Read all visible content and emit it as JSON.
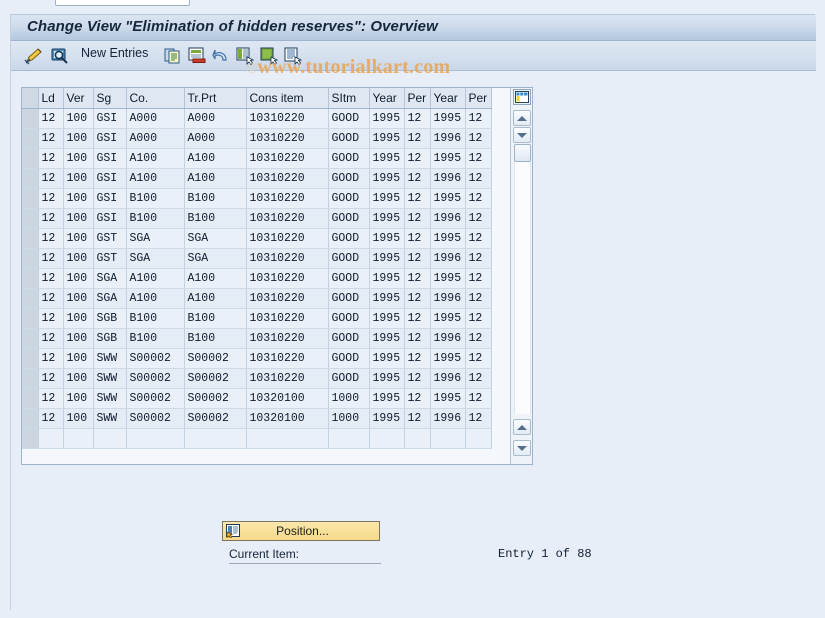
{
  "window": {
    "title": "Change View \"Elimination of hidden reserves\": Overview"
  },
  "watermark": {
    "copyright_mark": "©",
    "text": "www.tutorialkart.com",
    "color": "#e8a85c"
  },
  "toolbar": {
    "items": [
      {
        "name": "display-change-icon",
        "label": ""
      },
      {
        "name": "check-entries-icon",
        "label": ""
      },
      {
        "name": "new-entries-button",
        "label": "New Entries"
      },
      {
        "name": "copy-as-icon",
        "label": ""
      },
      {
        "name": "delete-icon",
        "label": ""
      },
      {
        "name": "undo-icon",
        "label": ""
      },
      {
        "name": "select-all-icon",
        "label": ""
      },
      {
        "name": "deselect-all-icon",
        "label": ""
      },
      {
        "name": "variant-icon",
        "label": ""
      }
    ],
    "new_entries_label": "New Entries"
  },
  "table": {
    "columns": [
      {
        "key": "ld",
        "label": "Ld"
      },
      {
        "key": "ver",
        "label": "Ver"
      },
      {
        "key": "sg",
        "label": "Sg"
      },
      {
        "key": "co",
        "label": "Co."
      },
      {
        "key": "trprt",
        "label": "Tr.Prt"
      },
      {
        "key": "cons",
        "label": "Cons item"
      },
      {
        "key": "sitm",
        "label": "SItm"
      },
      {
        "key": "year1",
        "label": "Year"
      },
      {
        "key": "per1",
        "label": "Per"
      },
      {
        "key": "year2",
        "label": "Year"
      },
      {
        "key": "per2",
        "label": "Per"
      }
    ],
    "rows": [
      [
        "12",
        "100",
        "GSI",
        "A000",
        "A000",
        "10310220",
        "GOOD",
        "1995",
        "12",
        "1995",
        "12"
      ],
      [
        "12",
        "100",
        "GSI",
        "A000",
        "A000",
        "10310220",
        "GOOD",
        "1995",
        "12",
        "1996",
        "12"
      ],
      [
        "12",
        "100",
        "GSI",
        "A100",
        "A100",
        "10310220",
        "GOOD",
        "1995",
        "12",
        "1995",
        "12"
      ],
      [
        "12",
        "100",
        "GSI",
        "A100",
        "A100",
        "10310220",
        "GOOD",
        "1995",
        "12",
        "1996",
        "12"
      ],
      [
        "12",
        "100",
        "GSI",
        "B100",
        "B100",
        "10310220",
        "GOOD",
        "1995",
        "12",
        "1995",
        "12"
      ],
      [
        "12",
        "100",
        "GSI",
        "B100",
        "B100",
        "10310220",
        "GOOD",
        "1995",
        "12",
        "1996",
        "12"
      ],
      [
        "12",
        "100",
        "GST",
        "SGA",
        "SGA",
        "10310220",
        "GOOD",
        "1995",
        "12",
        "1995",
        "12"
      ],
      [
        "12",
        "100",
        "GST",
        "SGA",
        "SGA",
        "10310220",
        "GOOD",
        "1995",
        "12",
        "1996",
        "12"
      ],
      [
        "12",
        "100",
        "SGA",
        "A100",
        "A100",
        "10310220",
        "GOOD",
        "1995",
        "12",
        "1995",
        "12"
      ],
      [
        "12",
        "100",
        "SGA",
        "A100",
        "A100",
        "10310220",
        "GOOD",
        "1995",
        "12",
        "1996",
        "12"
      ],
      [
        "12",
        "100",
        "SGB",
        "B100",
        "B100",
        "10310220",
        "GOOD",
        "1995",
        "12",
        "1995",
        "12"
      ],
      [
        "12",
        "100",
        "SGB",
        "B100",
        "B100",
        "10310220",
        "GOOD",
        "1995",
        "12",
        "1996",
        "12"
      ],
      [
        "12",
        "100",
        "SWW",
        "S00002",
        "S00002",
        "10310220",
        "GOOD",
        "1995",
        "12",
        "1995",
        "12"
      ],
      [
        "12",
        "100",
        "SWW",
        "S00002",
        "S00002",
        "10310220",
        "GOOD",
        "1995",
        "12",
        "1996",
        "12"
      ],
      [
        "12",
        "100",
        "SWW",
        "S00002",
        "S00002",
        "10320100",
        "1000",
        "1995",
        "12",
        "1995",
        "12"
      ],
      [
        "12",
        "100",
        "SWW",
        "S00002",
        "S00002",
        "10320100",
        "1000",
        "1995",
        "12",
        "1996",
        "12"
      ],
      [
        "",
        "",
        "",
        "",
        "",
        "",
        "",
        "",
        "",
        "",
        ""
      ]
    ]
  },
  "footer": {
    "position_button_label": "Position...",
    "current_item_label": "Current Item:",
    "entry_counter": "Entry 1 of 88"
  }
}
